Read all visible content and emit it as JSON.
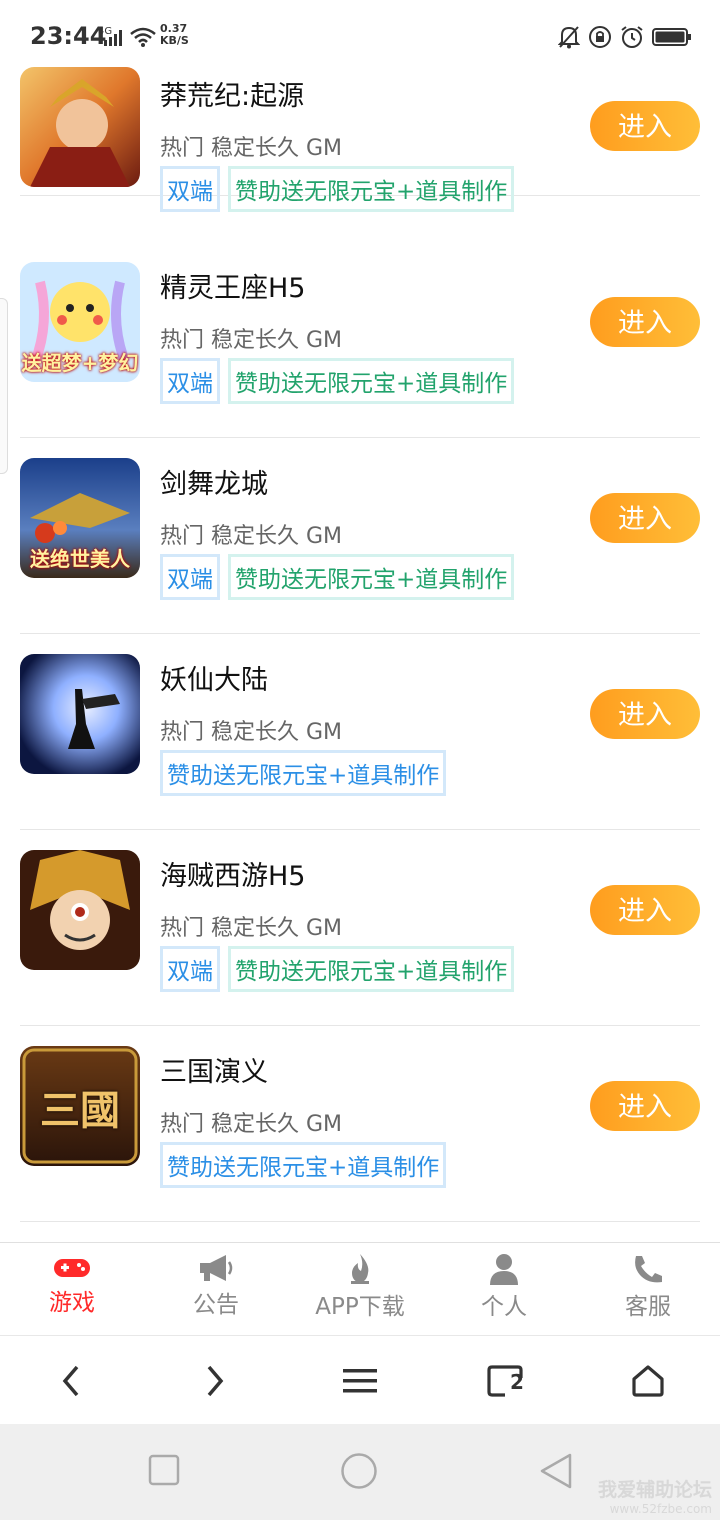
{
  "status_bar": {
    "time": "23:44",
    "network": "4G",
    "speed_value": "0.37",
    "speed_unit": "KB/S",
    "icons": [
      "signal-icon",
      "wifi-icon",
      "mute-bell-icon",
      "rotation-lock-icon",
      "alarm-icon",
      "battery-icon"
    ]
  },
  "games": [
    {
      "title": "莽荒纪:起源",
      "desc": "热门 稳定长久 GM",
      "tags": [
        {
          "text": "双端",
          "style": "blue"
        },
        {
          "text": "赞助送无限元宝+道具制作",
          "style": "green"
        }
      ],
      "button": "进入",
      "thumb_text": "",
      "thumb_colors": [
        "#6b1a10",
        "#e0782c",
        "#f3c46a"
      ]
    },
    {
      "title": "精灵王座H5",
      "desc": "热门 稳定长久 GM",
      "tags": [
        {
          "text": "双端",
          "style": "blue"
        },
        {
          "text": "赞助送无限元宝+道具制作",
          "style": "green"
        }
      ],
      "button": "进入",
      "thumb_text": "送超梦+梦幻",
      "thumb_colors": [
        "#bfe4ff",
        "#ffe36a",
        "#f5a6d8"
      ]
    },
    {
      "title": "剑舞龙城",
      "desc": "热门 稳定长久 GM",
      "tags": [
        {
          "text": "双端",
          "style": "blue"
        },
        {
          "text": "赞助送无限元宝+道具制作",
          "style": "green"
        }
      ],
      "button": "进入",
      "thumb_text": "送绝世美人",
      "thumb_colors": [
        "#1b3f8a",
        "#c8a03a",
        "#d63a1c"
      ]
    },
    {
      "title": "妖仙大陆",
      "desc": "热门 稳定长久 GM",
      "tags": [
        {
          "text": "赞助送无限元宝+道具制作",
          "style": "blue"
        }
      ],
      "button": "进入",
      "thumb_text": "",
      "thumb_colors": [
        "#0c1640",
        "#8fb0ff",
        "#e8eeff"
      ]
    },
    {
      "title": "海贼西游H5",
      "desc": "热门 稳定长久 GM",
      "tags": [
        {
          "text": "双端",
          "style": "blue"
        },
        {
          "text": "赞助送无限元宝+道具制作",
          "style": "green"
        }
      ],
      "button": "进入",
      "thumb_text": "",
      "thumb_colors": [
        "#3a1a0c",
        "#d59a2c",
        "#b02a1a"
      ]
    },
    {
      "title": "三国演义",
      "desc": "热门 稳定长久 GM",
      "tags": [
        {
          "text": "赞助送无限元宝+道具制作",
          "style": "blue"
        }
      ],
      "button": "进入",
      "thumb_text": "三國",
      "thumb_colors": [
        "#2a140a",
        "#6a3a14",
        "#f0c36a"
      ]
    }
  ],
  "tabs": [
    {
      "label": "游戏",
      "icon": "gamepad-icon",
      "active": true
    },
    {
      "label": "公告",
      "icon": "megaphone-icon",
      "active": false
    },
    {
      "label": "APP下载",
      "icon": "flame-icon",
      "active": false
    },
    {
      "label": "个人",
      "icon": "person-icon",
      "active": false
    },
    {
      "label": "客服",
      "icon": "phone-icon",
      "active": false
    }
  ],
  "browser_toolbar": {
    "tab_count": "2",
    "icons": [
      "back-icon",
      "forward-icon",
      "menu-icon",
      "tabs-icon",
      "home-icon"
    ]
  },
  "system_nav": {
    "icons": [
      "recent-apps-icon",
      "home-circle-icon",
      "back-triangle-icon"
    ]
  },
  "watermark": {
    "line1": "我爱辅助论坛",
    "line2": "www.52fzbe.com"
  },
  "colors": {
    "accent_orange": "#ffa52b",
    "active_tab": "#ff2a2a",
    "tag_blue": "#2b8fe6",
    "tag_green": "#22a36c"
  }
}
